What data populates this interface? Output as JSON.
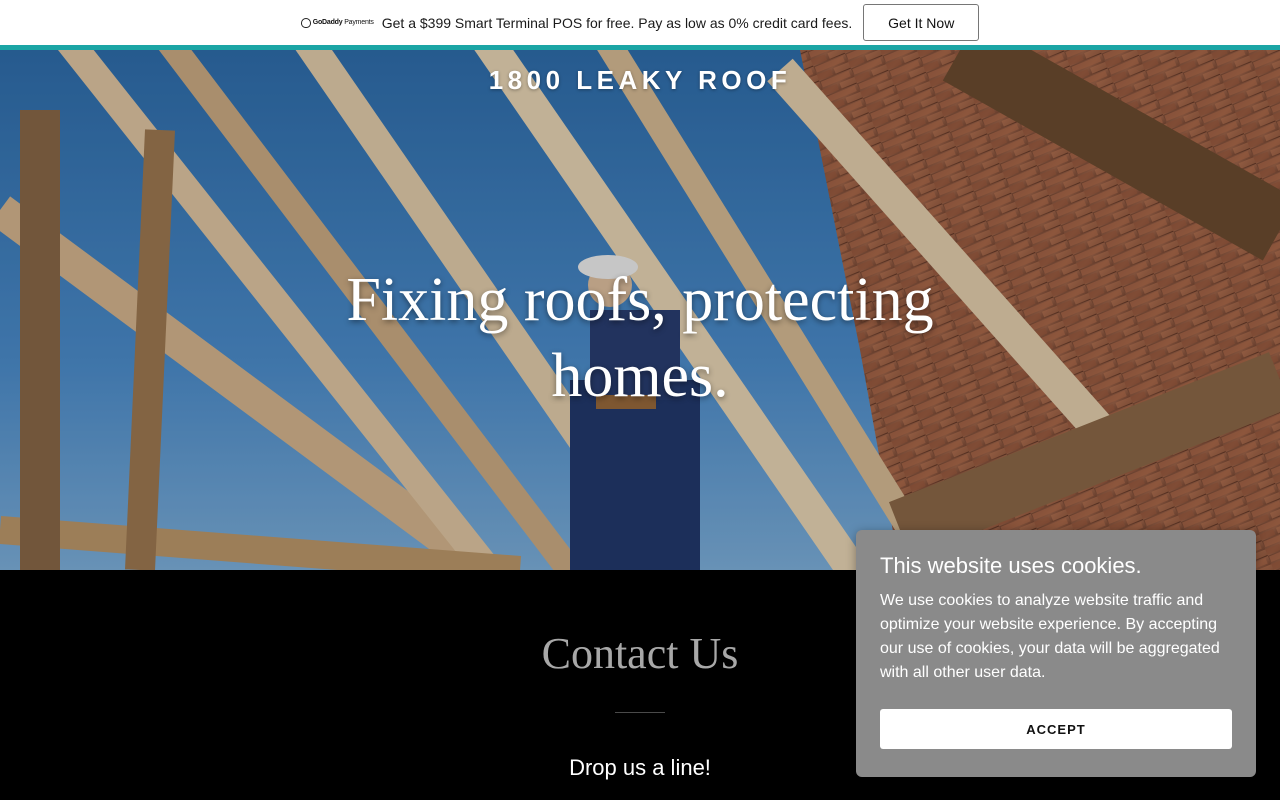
{
  "promo": {
    "logo_text_bold": "GoDaddy",
    "logo_text_light": "Payments",
    "message": "Get a $399 Smart Terminal POS for free. Pay as low as 0% credit card fees.",
    "cta_label": "Get It Now"
  },
  "hero": {
    "brand": "1800 LEAKY ROOF",
    "headline": "Fixing roofs, protecting homes."
  },
  "contact": {
    "title": "Contact Us",
    "subtitle": "Drop us a line!"
  },
  "cookie": {
    "title": "This website uses cookies.",
    "body": "We use cookies to analyze website traffic and optimize your website experience. By accepting our use of cookies, your data will be aggregated with all other user data.",
    "accept_label": "ACCEPT"
  },
  "colors": {
    "accent": "#1ba5a5",
    "cookie_bg": "#8a8a8a",
    "contact_title": "#a8a8a8"
  }
}
